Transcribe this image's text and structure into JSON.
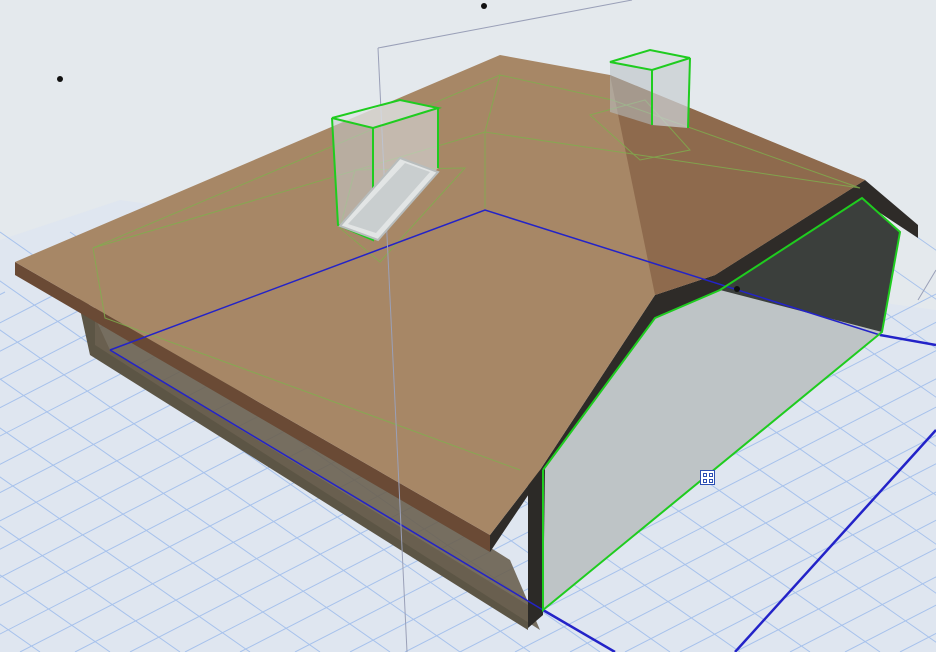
{
  "viewport": {
    "view": "3D",
    "background_color": "#e4e9ed",
    "grid_color": "#9ebcea",
    "floor_color": "#dfe6f0"
  },
  "model": {
    "roof_top_color": "#a78766",
    "roof_shadow_color": "#8a6a4f",
    "fascia_color": "#3a3632",
    "wall_color": "#5c5545",
    "gable_face_color": "#c0c6c8",
    "selection_color": "#1fcc1f",
    "reference_line_color": "#1f1fd4",
    "selected_elements": [
      "chimney-left",
      "chimney-right",
      "skylight",
      "gable-wall"
    ]
  },
  "edit_marker": {
    "icon": "element-edit-handle-icon"
  }
}
